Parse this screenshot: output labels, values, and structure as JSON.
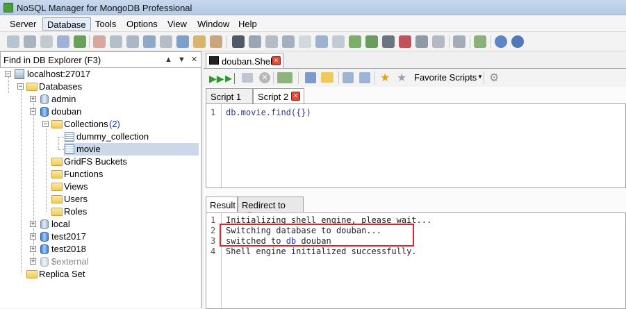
{
  "window": {
    "title": "NoSQL Manager for MongoDB Professional"
  },
  "menu": [
    "Server",
    "Database",
    "Tools",
    "Options",
    "View",
    "Window",
    "Help"
  ],
  "explorer": {
    "find_placeholder": "Find in DB Explorer (F3)",
    "tree": {
      "server": "localhost:27017",
      "databases": "Databases",
      "admin": "admin",
      "douban": "douban",
      "collections": "Collections",
      "collections_count": "(2)",
      "dummy_collection": "dummy_collection",
      "movie": "movie",
      "gridfs": "GridFS Buckets",
      "functions": "Functions",
      "views": "Views",
      "users": "Users",
      "roles": "Roles",
      "local": "local",
      "test2017": "test2017",
      "test2018": "test2018",
      "external": "$external",
      "replica_set": "Replica Set"
    }
  },
  "shell": {
    "doc_tab": "douban.Shell",
    "favorite_scripts": "Favorite Scripts",
    "script_tabs": [
      "Script 1",
      "Script 2"
    ],
    "editor_lines": [
      "db.movie.find({})"
    ],
    "result_tabs": [
      "Result",
      "Redirect to File"
    ],
    "output": {
      "l1": "Initializing shell engine, please wait...",
      "l2": "Switching database to douban...",
      "l3_pre": "switched to ",
      "l3_kw": "db",
      "l3_post": " douban",
      "l4": "Shell engine initialized successfully."
    },
    "line_numbers": [
      "1",
      "2",
      "3",
      "4"
    ]
  },
  "colors": {
    "highlight_box": "#d9262c"
  }
}
